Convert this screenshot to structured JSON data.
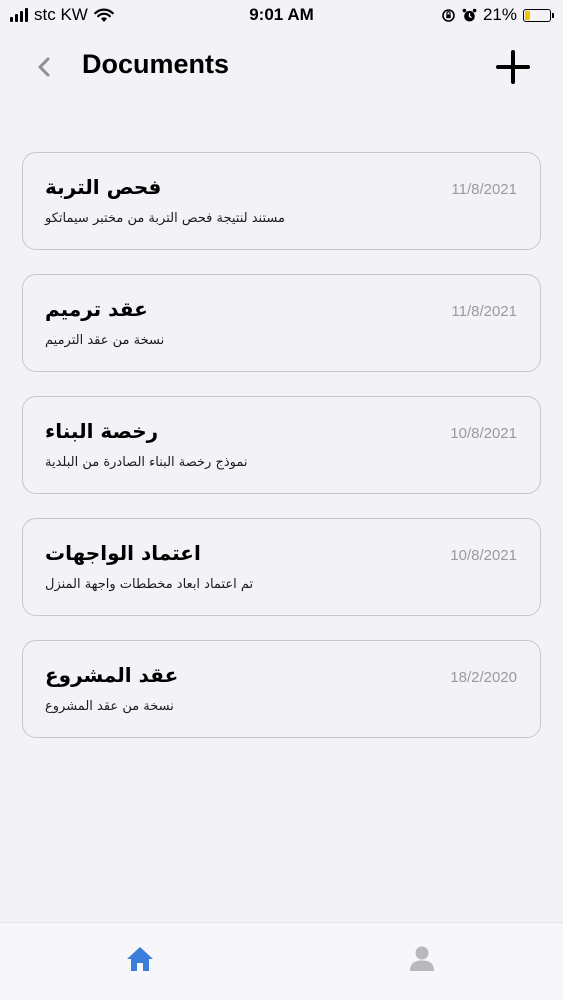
{
  "status_bar": {
    "carrier": "stc KW",
    "time": "9:01 AM",
    "battery_percent": "21%",
    "battery_level": 0.21,
    "icons": [
      "signal-icon",
      "wifi-icon",
      "orientation-lock-icon",
      "alarm-icon",
      "battery-icon"
    ]
  },
  "header": {
    "title": "Documents",
    "back_icon": "chevron-left-icon",
    "add_icon": "plus-icon"
  },
  "documents": [
    {
      "title": "فحص التربة",
      "description": "مستند لنتيجة فحص التربة من مختبر سيماتكو",
      "date": "11/8/2021"
    },
    {
      "title": "عقد ترميم",
      "description": "نسخة من عقد الترميم",
      "date": "11/8/2021"
    },
    {
      "title": "رخصة البناء",
      "description": "نموذج رخصة البناء الصادرة من البلدية",
      "date": "10/8/2021"
    },
    {
      "title": "اعتماد الواجهات",
      "description": "تم اعتماد ابعاد مخططات واجهة المنزل",
      "date": "10/8/2021"
    },
    {
      "title": "عقد المشروع",
      "description": "نسخة من عقد المشروع",
      "date": "18/2/2020"
    }
  ],
  "tab_bar": {
    "tabs": [
      {
        "icon": "home-icon",
        "active": true,
        "color": "#3b7ddd"
      },
      {
        "icon": "user-icon",
        "active": false,
        "color": "#b8b8be"
      }
    ]
  },
  "colors": {
    "background": "#f2f2f7",
    "card_border": "#c7c7cc",
    "date_text": "#9a9aa0",
    "accent": "#3b7ddd",
    "battery": "#f2c400"
  }
}
